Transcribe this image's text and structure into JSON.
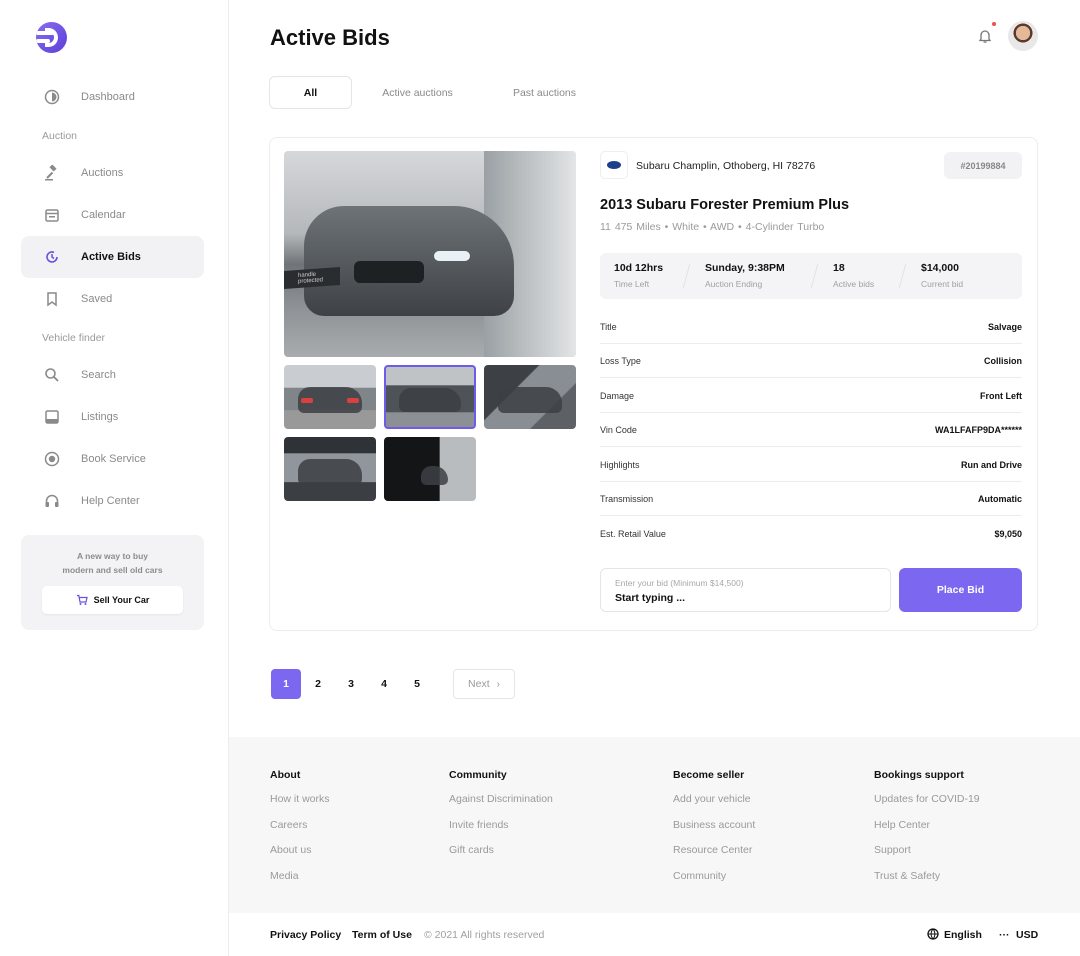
{
  "sidebar": {
    "items": [
      {
        "label": "Dashboard",
        "icon": "dashboard-icon"
      },
      {
        "label": "Auctions",
        "icon": "gavel-icon"
      },
      {
        "label": "Calendar",
        "icon": "calendar-icon"
      },
      {
        "label": "Active Bids",
        "icon": "bids-icon"
      },
      {
        "label": "Saved",
        "icon": "bookmark-icon"
      },
      {
        "label": "Search",
        "icon": "search-icon"
      },
      {
        "label": "Listings",
        "icon": "listings-icon"
      },
      {
        "label": "Book Service",
        "icon": "service-icon"
      },
      {
        "label": "Help Center",
        "icon": "headset-icon"
      }
    ],
    "sections": [
      "Auction",
      "Vehicle finder"
    ],
    "promo": {
      "line1": "A new way to buy",
      "line2": "modern and sell old cars",
      "button": "Sell Your Car"
    }
  },
  "header": {
    "title": "Active Bids"
  },
  "tabs": [
    {
      "label": "All",
      "active": true
    },
    {
      "label": "Active auctions",
      "active": false
    },
    {
      "label": "Past auctions",
      "active": false
    }
  ],
  "listing": {
    "seller": "Subaru Champlin, Othoberg, HI 78276",
    "lot": "#20199884",
    "title": "2013 Subaru Forester Premium Plus",
    "specs": "11 475 Miles  •  White  •  AWD  •  4-Cylinder Turbo",
    "plate_text": "handle protected",
    "stats": [
      {
        "value": "10d 12hrs",
        "label": "Time Left"
      },
      {
        "value": "Sunday, 9:38PM",
        "label": "Auction Ending"
      },
      {
        "value": "18",
        "label": "Active bids"
      },
      {
        "value": "$14,000",
        "label": "Current bid"
      }
    ],
    "details": [
      {
        "key": "Title",
        "value": "Salvage"
      },
      {
        "key": "Loss Type",
        "value": "Collision"
      },
      {
        "key": "Damage",
        "value": "Front Left"
      },
      {
        "key": "Vin Code",
        "value": "WA1LFAFP9DA******"
      },
      {
        "key": "Highlights",
        "value": "Run and Drive"
      },
      {
        "key": "Transmission",
        "value": "Automatic"
      },
      {
        "key": "Est. Retail Value",
        "value": "$9,050"
      }
    ],
    "bid_placeholder": "Enter your bid (Minimum $14,500)",
    "bid_value": "Start typing ...",
    "place_bid": "Place Bid"
  },
  "pagination": {
    "pages": [
      "1",
      "2",
      "3",
      "4",
      "5"
    ],
    "current": "1",
    "next": "Next"
  },
  "footer": {
    "columns": [
      {
        "heading": "About",
        "links": [
          "How it works",
          "Careers",
          "About us",
          "Media"
        ]
      },
      {
        "heading": "Community",
        "links": [
          "Against Discrimination",
          "Invite friends",
          "Gift cards"
        ]
      },
      {
        "heading": "Become seller",
        "links": [
          "Add your vehicle",
          "Business account",
          "Resource Center",
          "Community"
        ]
      },
      {
        "heading": "Bookings support",
        "links": [
          "Updates for COVID-19",
          "Help Center",
          "Support",
          "Trust & Safety"
        ]
      }
    ],
    "privacy": "Privacy Policy",
    "terms": "Term of Use",
    "copyright": "© 2021 All rights reserved",
    "language": "English",
    "currency": "USD"
  },
  "colors": {
    "accent": "#7c67f0",
    "brand": "#6a4fe0"
  }
}
